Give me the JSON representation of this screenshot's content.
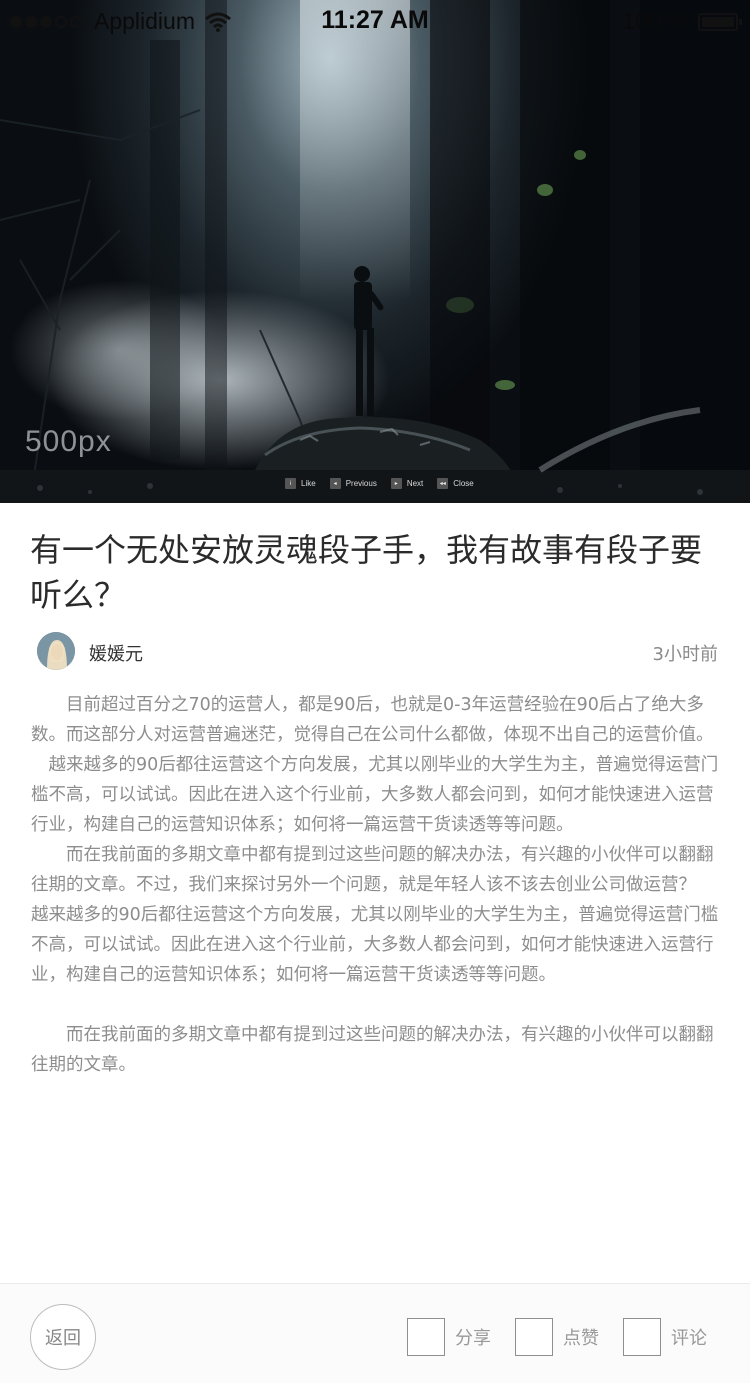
{
  "status_bar": {
    "carrier": "Applidium",
    "time": "11:27 AM",
    "battery": "100 %",
    "signal_strength": 3,
    "signal_total": 5
  },
  "hero": {
    "watermark": "500px",
    "controls": [
      {
        "icon": "like-icon",
        "label": "Like"
      },
      {
        "icon": "previous-icon",
        "label": "Previous"
      },
      {
        "icon": "next-icon",
        "label": "Next"
      },
      {
        "icon": "close-icon",
        "label": "Close"
      }
    ]
  },
  "article": {
    "title": "有一个无处安放灵魂段子手，我有故事有段子要听么？",
    "author": "媛媛元",
    "time": "3小时前",
    "paragraphs": [
      "　　目前超过百分之70的运营人，都是90后，也就是0-3年运营经验在90后占了绝大多数。而这部分人对运营普遍迷茫，觉得自己在公司什么都做，体现不出自己的运营价值。",
      "　越来越多的90后都往运营这个方向发展，尤其以刚毕业的大学生为主，普遍觉得运营门槛不高，可以试试。因此在进入这个行业前，大多数人都会问到，如何才能快速进入运营行业，构建自己的运营知识体系；如何将一篇运营干货读透等等问题。",
      "　　而在我前面的多期文章中都有提到过这些问题的解决办法，有兴趣的小伙伴可以翻翻往期的文章。不过，我们来探讨另外一个问题，就是年轻人该不该去创业公司做运营？",
      " 越来越多的90后都往运营这个方向发展，尤其以刚毕业的大学生为主，普遍觉得运营门槛不高，可以试试。因此在进入这个行业前，大多数人都会问到，如何才能快速进入运营行业，构建自己的运营知识体系；如何将一篇运营干货读透等等问题。",
      "　　而在我前面的多期文章中都有提到过这些问题的解决办法，有兴趣的小伙伴可以翻翻往期的文章。"
    ]
  },
  "bottom_bar": {
    "back": "返回",
    "share": "分享",
    "like": "点赞",
    "comment": "评论"
  }
}
